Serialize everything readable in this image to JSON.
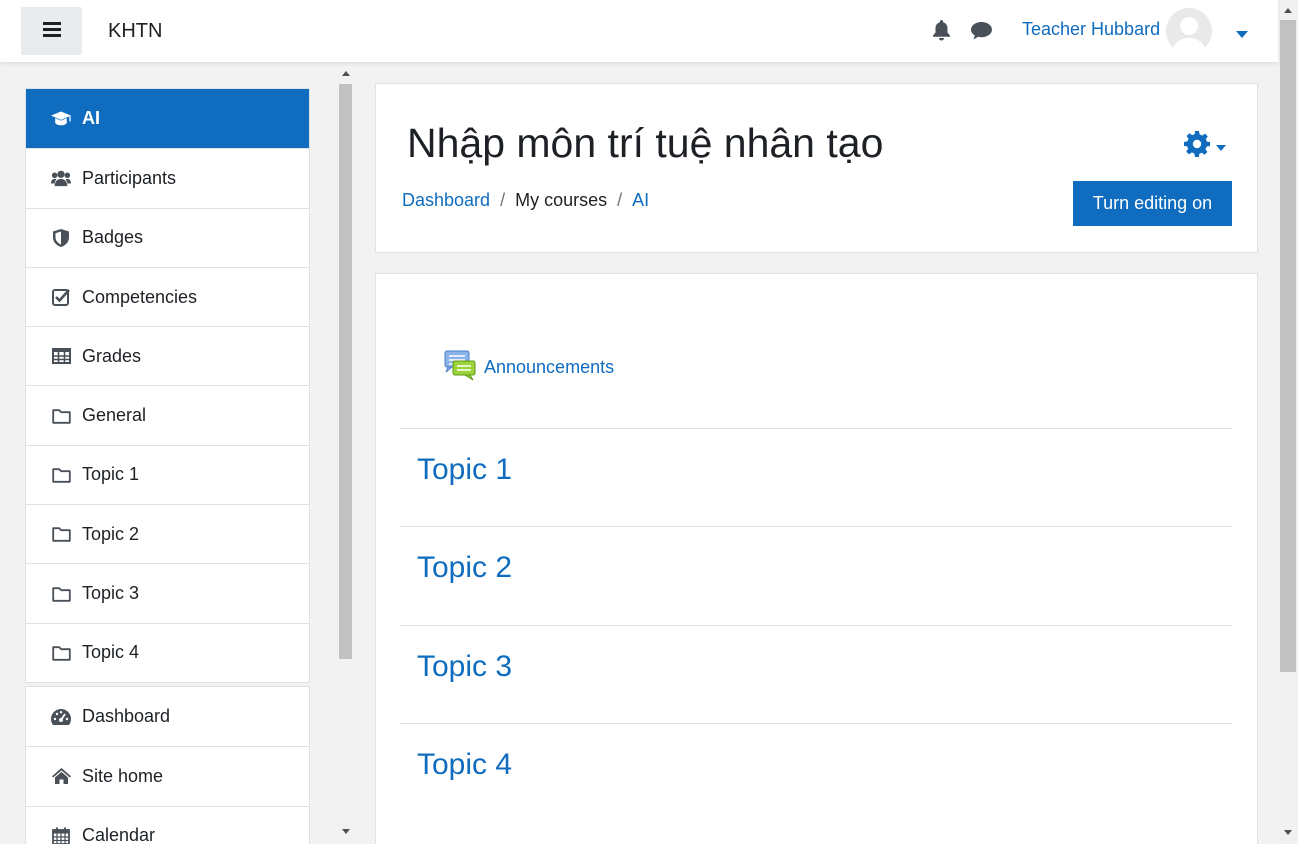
{
  "navbar": {
    "brand": "KHTN",
    "user_name": "Teacher Hubbard",
    "icons": [
      "menu-icon",
      "bell-icon",
      "chat-icon",
      "avatar",
      "caret-down-icon"
    ]
  },
  "drawer": {
    "course_items": [
      {
        "label": "AI",
        "icon": "graduation-cap-icon",
        "active": true
      },
      {
        "label": "Participants",
        "icon": "users-icon"
      },
      {
        "label": "Badges",
        "icon": "shield-icon"
      },
      {
        "label": "Competencies",
        "icon": "check-square-icon"
      },
      {
        "label": "Grades",
        "icon": "table-icon"
      },
      {
        "label": "General",
        "icon": "folder-icon"
      },
      {
        "label": "Topic 1",
        "icon": "folder-icon"
      },
      {
        "label": "Topic 2",
        "icon": "folder-icon"
      },
      {
        "label": "Topic 3",
        "icon": "folder-icon"
      },
      {
        "label": "Topic 4",
        "icon": "folder-icon"
      }
    ],
    "site_items": [
      {
        "label": "Dashboard",
        "icon": "dashboard-icon"
      },
      {
        "label": "Site home",
        "icon": "home-icon"
      },
      {
        "label": "Calendar",
        "icon": "calendar-icon"
      }
    ]
  },
  "header": {
    "title": "Nhập môn trí tuệ nhân tạo",
    "breadcrumb": [
      "Dashboard",
      "My courses",
      "AI"
    ],
    "edit_button": "Turn editing on"
  },
  "content": {
    "announcements": "Announcements",
    "topics": [
      "Topic 1",
      "Topic 2",
      "Topic 3",
      "Topic 4"
    ]
  },
  "colors": {
    "primary": "#0f6cbf",
    "background": "#f2f2f2",
    "border": "#dee2e6"
  }
}
